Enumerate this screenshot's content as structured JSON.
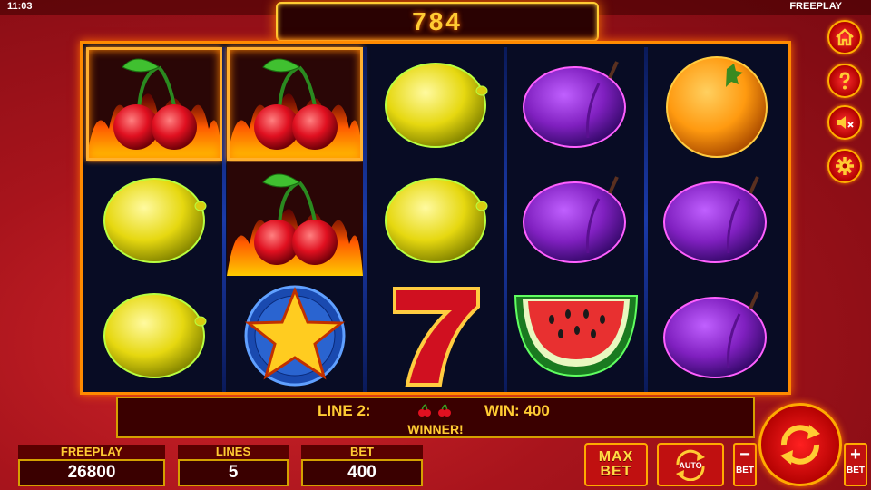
{
  "status": {
    "time": "11:03",
    "mode": "FREEPLAY"
  },
  "win_display": "784",
  "reels": [
    [
      "cherry",
      "lemon",
      "lemon"
    ],
    [
      "cherry",
      "cherry",
      "star"
    ],
    [
      "lemon",
      "lemon",
      "seven"
    ],
    [
      "plum",
      "plum",
      "watermelon"
    ],
    [
      "orange",
      "plum",
      "plum"
    ]
  ],
  "highlighted_cells": [
    "reel1-row1",
    "reel2-row1",
    "reel2-row2"
  ],
  "info": {
    "line_label": "LINE 2:",
    "win_label": "WIN: 400",
    "message": "WINNER!",
    "line_symbols": [
      "cherry-icon",
      "cherry-icon"
    ]
  },
  "stats": {
    "freeplay_label": "FREEPLAY",
    "freeplay_value": "26800",
    "lines_label": "LINES",
    "lines_value": "5",
    "bet_label": "BET",
    "bet_value": "400"
  },
  "buttons": {
    "max_label_1": "MAX",
    "max_label_2": "BET",
    "auto_label": "AUTO",
    "bet_minus_symbol": "−",
    "bet_minus_label": "BET",
    "bet_plus_symbol": "+",
    "bet_plus_label": "BET"
  },
  "side_icons": [
    "home-icon",
    "help-icon",
    "sound-muted-icon",
    "settings-icon"
  ],
  "colors": {
    "accent_gold": "#ffcc33",
    "frame_orange": "#ff8a00",
    "reel_bg": "#080c24",
    "button_red": "#c01010"
  }
}
